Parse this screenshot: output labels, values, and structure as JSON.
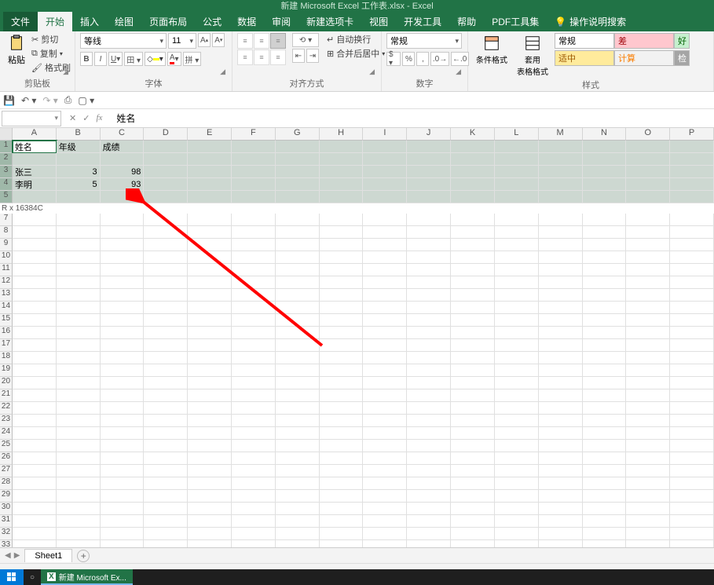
{
  "title_bar": "新建 Microsoft Excel 工作表.xlsx  -  Excel",
  "menu": {
    "file": "文件",
    "home": "开始",
    "insert": "插入",
    "draw": "绘图",
    "layout": "页面布局",
    "formulas": "公式",
    "data": "数据",
    "review": "审阅",
    "addin": "新建选项卡",
    "view": "视图",
    "developer": "开发工具",
    "help": "帮助",
    "pdf": "PDF工具集",
    "tell_me": "操作说明搜索"
  },
  "ribbon": {
    "clipboard": {
      "paste": "粘贴",
      "cut": "剪切",
      "copy": "复制",
      "format_painter": "格式刷",
      "label": "剪贴板"
    },
    "font": {
      "name": "等线",
      "size": "11",
      "label": "字体"
    },
    "alignment": {
      "wrap": "自动换行",
      "merge": "合并后居中",
      "label": "对齐方式"
    },
    "number": {
      "format": "常规",
      "label": "数字"
    },
    "styles": {
      "cond": "条件格式",
      "table": "套用\n表格格式",
      "normal": "常规",
      "bad": "差",
      "good": "好",
      "neutral": "适中",
      "calc": "计算",
      "check": "检",
      "label": "样式"
    }
  },
  "formula_bar": {
    "namebox": "",
    "value": "姓名"
  },
  "columns": [
    "A",
    "B",
    "C",
    "D",
    "E",
    "F",
    "G",
    "H",
    "I",
    "J",
    "K",
    "L",
    "M",
    "N",
    "O",
    "P"
  ],
  "rows_visible": 33,
  "selected_rows": [
    1,
    2,
    3,
    4,
    5
  ],
  "data_rows": {
    "1": {
      "A": "姓名",
      "B": "年级",
      "C": "成绩"
    },
    "3": {
      "A": "张三",
      "B": "3",
      "C": "98"
    },
    "4": {
      "A": "李明",
      "B": "5",
      "C": "93"
    }
  },
  "selection_status": "R x 16384C",
  "active_cell": {
    "row": 1,
    "col": "A"
  },
  "sheet_tabs": {
    "sheet1": "Sheet1"
  },
  "taskbar": {
    "excel_task": "新建 Microsoft Ex..."
  }
}
